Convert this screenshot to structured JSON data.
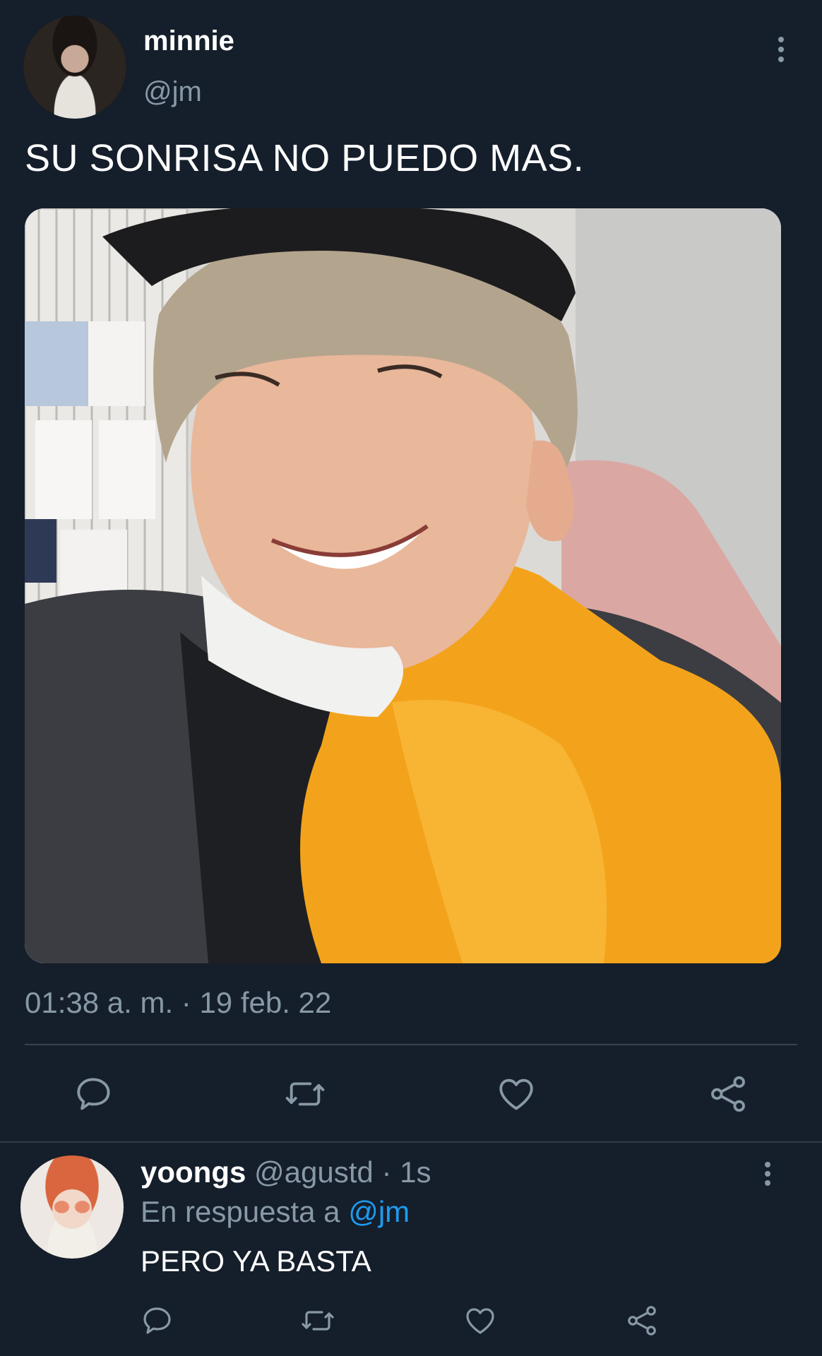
{
  "tweet": {
    "author_name": "minnie",
    "author_handle": "@jm",
    "text": "SU SONRISA NO PUEDO MAS.",
    "timestamp": "01:38 a. m. · 19 feb. 22",
    "actions": [
      {
        "name": "reply-button",
        "icon": "comment-icon"
      },
      {
        "name": "retweet-button",
        "icon": "retweet-icon"
      },
      {
        "name": "like-button",
        "icon": "heart-icon"
      },
      {
        "name": "share-button",
        "icon": "share-icon"
      }
    ]
  },
  "reply": {
    "author_name": "yoongs",
    "author_handle": "@agustd",
    "separator": "·",
    "time": "1s",
    "replying_to_label": "En respuesta a",
    "replying_to_handle": "@jm",
    "text": "PERO YA BASTA"
  },
  "colors": {
    "background": "#151e2b",
    "secondary_text": "#8899a6",
    "link": "#1d9bf0",
    "divider": "#38444d"
  }
}
